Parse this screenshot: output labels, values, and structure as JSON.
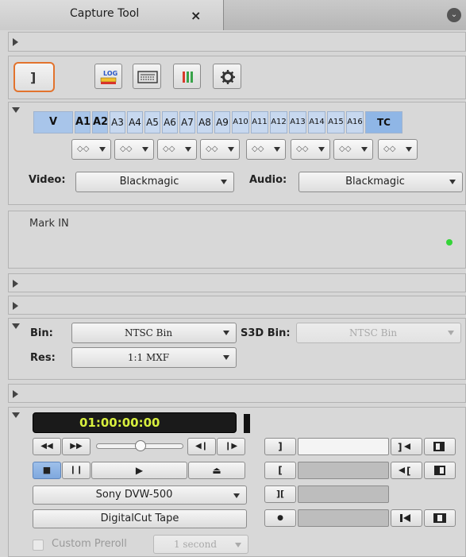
{
  "window": {
    "tab_title": "Capture Tool",
    "close_glyph": "×",
    "menu_glyph": "⌄"
  },
  "toolbar": {
    "mark_glyph": "]",
    "log_label": "LOG",
    "icons": [
      "log-mode-icon",
      "deck-icon",
      "audio-meter-icon",
      "gear-icon"
    ]
  },
  "tracks": {
    "items": [
      "V",
      "A1",
      "A2",
      "A3",
      "A4",
      "A5",
      "A6",
      "A7",
      "A8",
      "A9",
      "A10",
      "A11",
      "A12",
      "A13",
      "A14",
      "A15",
      "A16",
      "TC"
    ],
    "channel_map_value": "◇◇"
  },
  "sources": {
    "video_label": "Video:",
    "video_value": "Blackmagic",
    "audio_label": "Audio:",
    "audio_value": "Blackmagic"
  },
  "status": {
    "message": "Mark IN",
    "indicator_color": "#35d438"
  },
  "target": {
    "bin_label": "Bin:",
    "bin_value": "NTSC Bin",
    "s3d_label": "S3D Bin:",
    "s3d_value": "NTSC Bin",
    "res_label": "Res:",
    "res_value": "1:1  MXF"
  },
  "deck": {
    "timecode": "01:00:00:00",
    "timecode_color": "#d8ef3e",
    "rewind": "◀◀",
    "fast_forward": "▶▶",
    "step_back": "◀❙",
    "step_fwd": "❙▶",
    "stop": "■",
    "pause": "❙❙",
    "play": "▶",
    "eject": "⏏",
    "deck_value": "Sony DVW-500",
    "tape_label": "DigitalCut Tape",
    "preroll_label": "Custom Preroll",
    "preroll_value": "1 second",
    "mark_in_glyph": "[",
    "mark_out_glyph": "]",
    "duration_glyph": "][",
    "tape_glyph": "●"
  }
}
